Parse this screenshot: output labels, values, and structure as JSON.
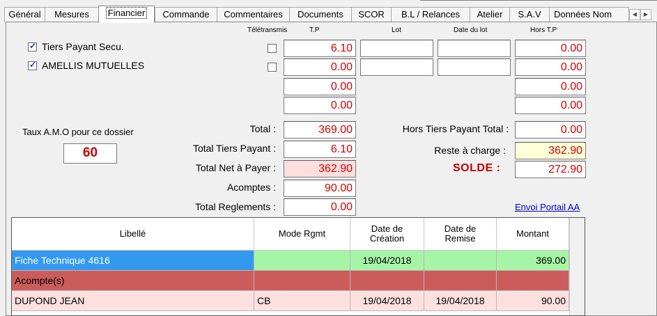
{
  "tabs": [
    "Général",
    "Mesures",
    "Financier",
    "Commande",
    "Commentaires",
    "Documents",
    "SCOR",
    "B.L / Relances",
    "Atelier",
    "S.A.V",
    "Données Nom"
  ],
  "active_tab": "Financier",
  "headers": {
    "teletransmis": "Télétransmis",
    "tp": "T.P",
    "lot": "Lot",
    "date_lot": "Date du lot",
    "hors_tp": "Hors T.P"
  },
  "payers": [
    {
      "label": "Tiers Payant Secu.",
      "checked": true
    },
    {
      "label": "AMELLIS MUTUELLES",
      "checked": true
    }
  ],
  "tp_values": [
    "6.10",
    "0.00",
    "0.00",
    "0.00"
  ],
  "hors_tp_values": [
    "0.00",
    "0.00",
    "0.00",
    "0.00"
  ],
  "taux": {
    "label": "Taux A.M.O pour ce dossier",
    "value": "60"
  },
  "totals": {
    "total_label": "Total :",
    "total": "369.00",
    "tiers_payant_label": "Total Tiers Payant :",
    "tiers_payant": "6.10",
    "net_label": "Total Net à Payer :",
    "net": "362.90",
    "acomptes_label": "Acomptes :",
    "acomptes": "90.00",
    "reglements_label": "Total Reglements :",
    "reglements": "0.00",
    "hors_tp_total_label": "Hors Tiers Payant Total :",
    "hors_tp_total": "0.00",
    "reste_label": "Reste à charge :",
    "reste": "362.90",
    "solde_label": "SOLDE :",
    "solde": "272.90"
  },
  "portal_link": "Envoi Portail AA",
  "grid": {
    "columns": [
      "Libellé",
      "Mode Rgmt",
      "Date de\nCréation",
      "Date de\nRemise",
      "Montant"
    ],
    "rows": [
      {
        "libelle": "Fiche Technique 4616",
        "mode": "",
        "creation": "19/04/2018",
        "remise": "",
        "montant": "369.00"
      },
      {
        "libelle": "Acompte(s)",
        "mode": "",
        "creation": "",
        "remise": "",
        "montant": ""
      },
      {
        "libelle": "DUPOND JEAN",
        "mode": "CB",
        "creation": "19/04/2018",
        "remise": "19/04/2018",
        "montant": "90.00"
      }
    ]
  },
  "colors": {
    "row_blue": "#3399ee",
    "row_green": "#a6f5a6",
    "row_red": "#cc5c5c",
    "row_pink": "#ffe0e0",
    "value_red": "#d40000"
  }
}
